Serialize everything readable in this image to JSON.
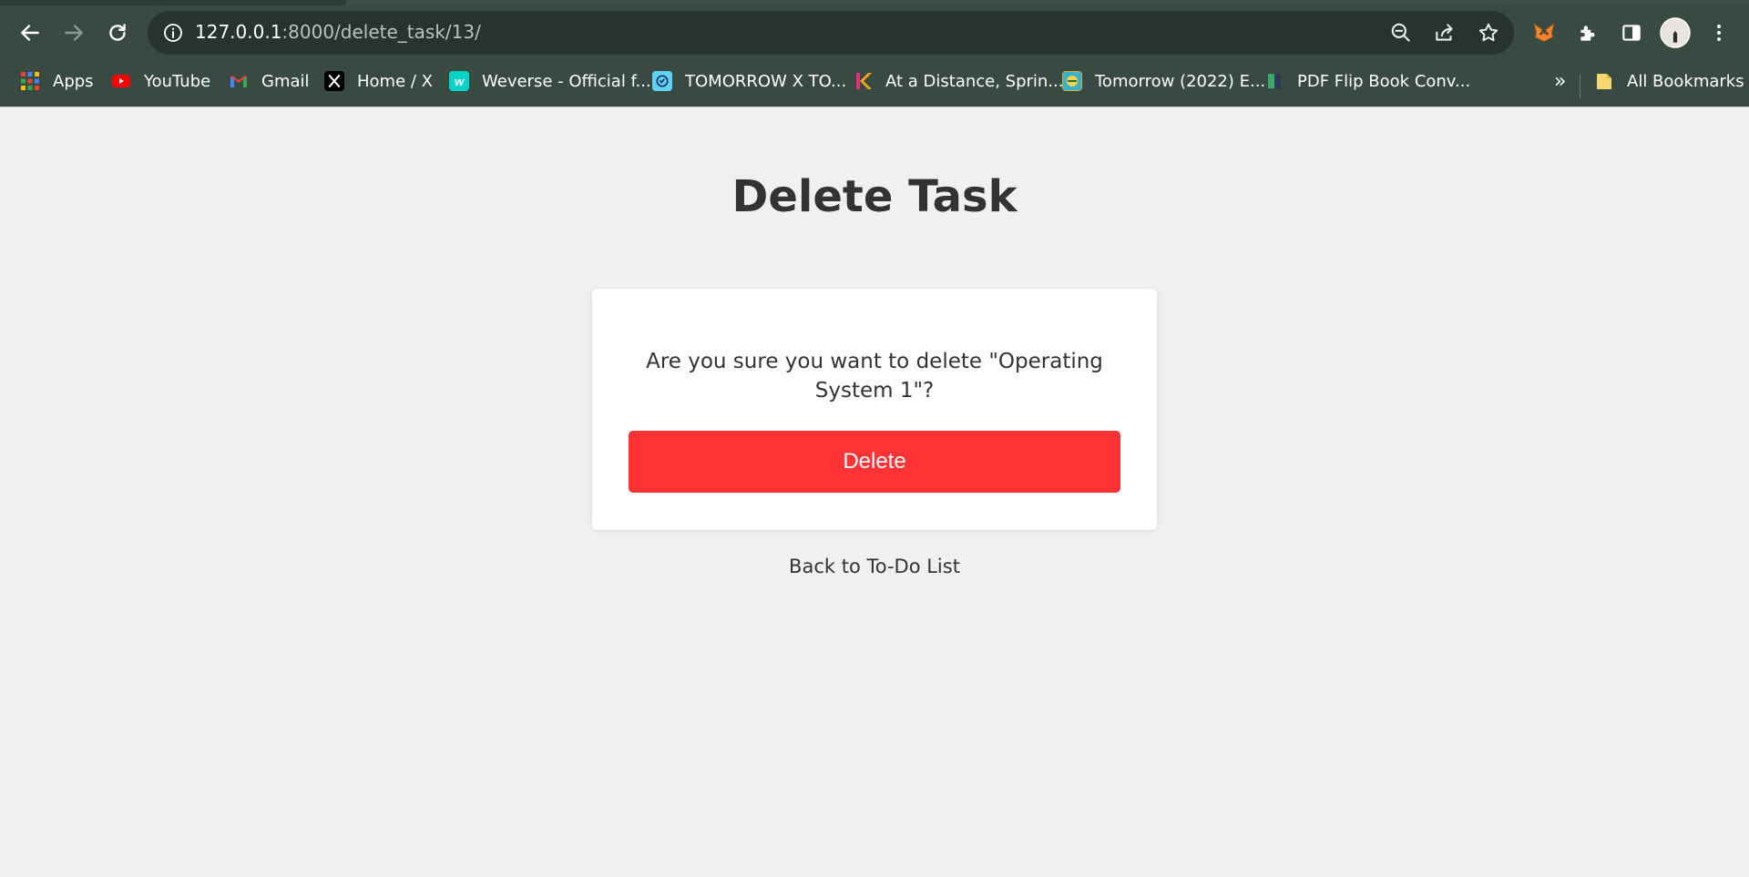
{
  "browser": {
    "url_host": "127.0.0.1",
    "url_rest": ":8000/delete_task/13/",
    "bookmarks": [
      {
        "label": "Apps",
        "icon": "apps-grid-icon",
        "color": "#4285f4"
      },
      {
        "label": "YouTube",
        "icon": "youtube-icon",
        "color": "#ff0000"
      },
      {
        "label": "Gmail",
        "icon": "gmail-icon",
        "color": "#ea4335"
      },
      {
        "label": "Home / X",
        "icon": "x-logo-icon",
        "color": "#000000"
      },
      {
        "label": "Weverse - Official f...",
        "icon": "weverse-icon",
        "color": "#07d3c9"
      },
      {
        "label": "TOMORROW X TO...",
        "icon": "txt-icon",
        "color": "#5fd4f1"
      },
      {
        "label": "At a Distance, Sprin...",
        "icon": "kodansha-icon",
        "color": "#e2337a"
      },
      {
        "label": "Tomorrow (2022) E...",
        "icon": "drama-icon",
        "color": "#d8b530"
      },
      {
        "label": "PDF Flip Book Conv...",
        "icon": "book-icon",
        "color": "#3fa86b"
      }
    ],
    "overflow_label": "»",
    "all_bookmarks_label": "All Bookmarks",
    "accent_color": "#394a42"
  },
  "page": {
    "title": "Delete Task",
    "confirm_text": "Are you sure you want to delete \"Operating System 1\"?",
    "delete_label": "Delete",
    "back_label": "Back to To-Do List",
    "danger_color": "#ff3333"
  }
}
